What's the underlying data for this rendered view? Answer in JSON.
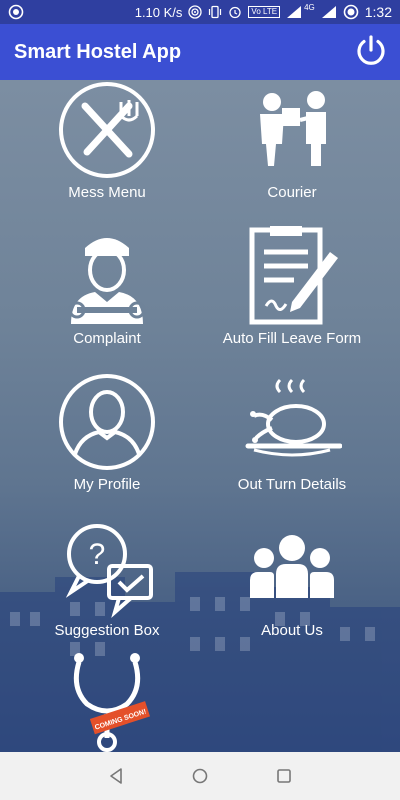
{
  "status_bar": {
    "net_speed": "1.10 K/s",
    "volte": "Vo LTE",
    "network": "4G",
    "time": "1:32"
  },
  "app_bar": {
    "title": "Smart Hostel App",
    "power_icon": "power-icon"
  },
  "menu": [
    {
      "label": "Mess Menu",
      "icon": "fork-knife-icon"
    },
    {
      "label": "Courier",
      "icon": "courier-delivery-icon"
    },
    {
      "label": "Complaint",
      "icon": "repairman-icon"
    },
    {
      "label": "Auto Fill Leave Form",
      "icon": "form-pencil-icon"
    },
    {
      "label": "My Profile",
      "icon": "user-profile-icon"
    },
    {
      "label": "Out Turn Details",
      "icon": "food-platter-icon"
    },
    {
      "label": "Suggestion Box",
      "icon": "chat-question-icon"
    },
    {
      "label": "About Us",
      "icon": "people-group-icon"
    },
    {
      "label": "",
      "icon": "stethoscope-icon",
      "badge": "COMING SOON!"
    }
  ],
  "colors": {
    "status_bar": "#2f3fa0",
    "app_bar": "#3b4fd3",
    "badge": "#e4502a"
  }
}
